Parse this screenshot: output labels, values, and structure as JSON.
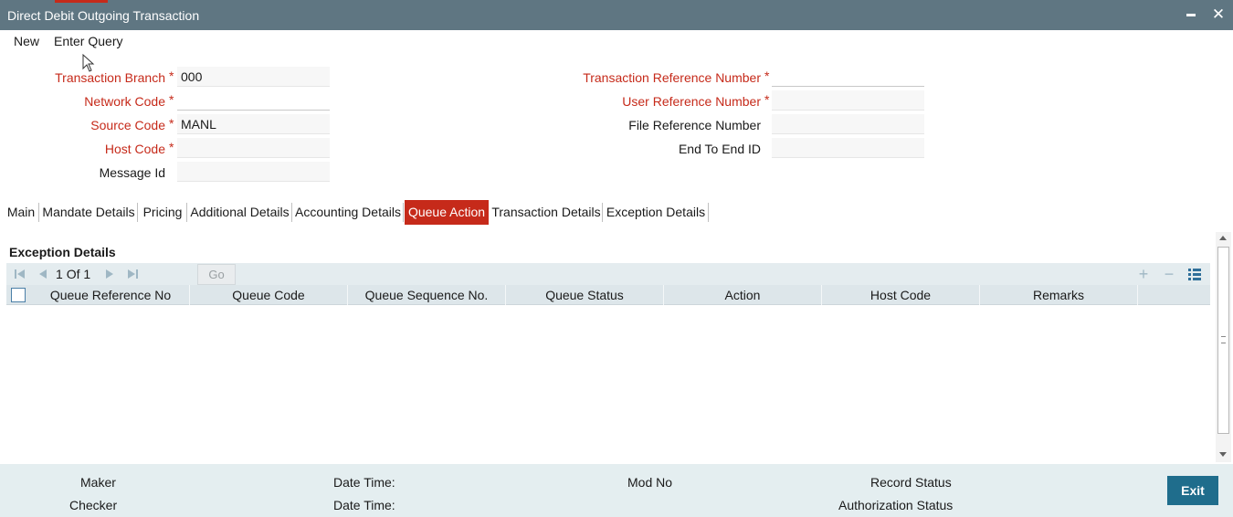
{
  "window": {
    "title": "Direct Debit Outgoing Transaction",
    "minimize_glyph": "▬",
    "close_glyph": "✕"
  },
  "menu": {
    "new_label": "New",
    "enter_query_label": "Enter Query"
  },
  "form": {
    "transaction_branch": {
      "label": "Transaction Branch",
      "value": "000"
    },
    "network_code": {
      "label": "Network Code",
      "value": ""
    },
    "source_code": {
      "label": "Source Code",
      "value": "MANL"
    },
    "host_code": {
      "label": "Host Code",
      "value": ""
    },
    "message_id": {
      "label": "Message Id",
      "value": ""
    },
    "transaction_reference_number": {
      "label": "Transaction Reference Number",
      "value": ""
    },
    "user_reference_number": {
      "label": "User Reference Number",
      "value": ""
    },
    "file_reference_number": {
      "label": "File Reference Number",
      "value": ""
    },
    "end_to_end_id": {
      "label": "End To End ID",
      "value": ""
    },
    "required_marker": "*"
  },
  "tabs": [
    {
      "label": "Main",
      "active": false
    },
    {
      "label": "Mandate Details",
      "active": false
    },
    {
      "label": "Pricing",
      "active": false
    },
    {
      "label": "Additional Details",
      "active": false
    },
    {
      "label": "Accounting Details",
      "active": false
    },
    {
      "label": "Queue Action",
      "active": true
    },
    {
      "label": "Transaction Details",
      "active": false
    },
    {
      "label": "Exception Details",
      "active": false
    }
  ],
  "exception_section": {
    "title": "Exception Details",
    "pager": {
      "current_page": "1",
      "of_label": "Of",
      "total_pages": "1",
      "go_label": "Go"
    },
    "toolbar_icons": [
      "add-row-icon",
      "delete-row-icon",
      "columns-icon"
    ],
    "columns": [
      "Queue Reference No",
      "Queue Code",
      "Queue Sequence No.",
      "Queue Status",
      "Action",
      "Host Code",
      "Remarks"
    ],
    "rows": []
  },
  "footer": {
    "maker_label": "Maker",
    "checker_label": "Checker",
    "date_time_label": "Date Time:",
    "mod_no_label": "Mod No",
    "record_status_label": "Record Status",
    "authorization_status_label": "Authorization Status",
    "exit_label": "Exit"
  },
  "colors": {
    "title_bar": "#5f7682",
    "required_red": "#c62a1a",
    "active_tab": "#c62a1a",
    "grid_header": "#dde6ea",
    "footer_bg": "#e4eef0",
    "exit_button": "#1f6d8c"
  }
}
